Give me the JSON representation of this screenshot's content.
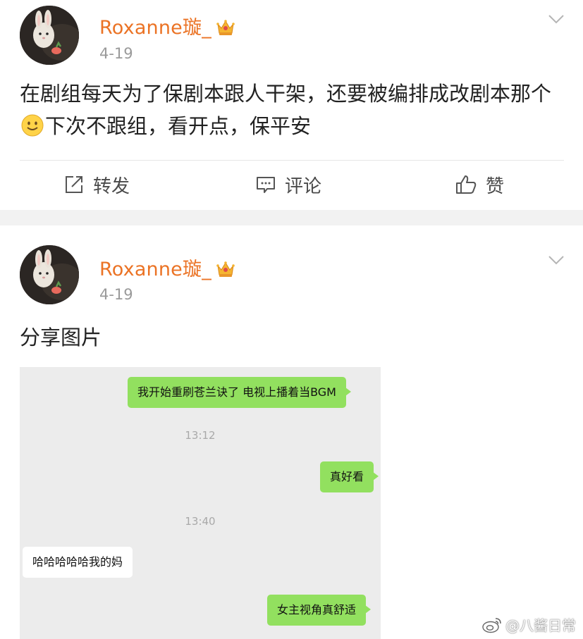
{
  "posts": [
    {
      "username": "Roxanne璇_",
      "date": "4-19",
      "text_before_emoji": "在剧组每天为了保剧本跟人干架，还要被编排成改剧本那个",
      "emoji": "smile-emoji",
      "text_after_emoji": "下次不跟组，看开点，保平安",
      "actions": {
        "repost": "转发",
        "comment": "评论",
        "like": "赞"
      }
    },
    {
      "username": "Roxanne璇_",
      "date": "4-19",
      "text": "分享图片",
      "shared_image": {
        "messages": [
          {
            "side": "me",
            "text": "我开始重刷苍兰诀了 电视上播着当BGM"
          },
          {
            "type": "time",
            "text": "13:12"
          },
          {
            "side": "me",
            "text": "真好看"
          },
          {
            "type": "time",
            "text": "13:40"
          },
          {
            "side": "them",
            "text": "哈哈哈哈哈我的妈"
          },
          {
            "side": "me",
            "text": "女主视角真舒适"
          }
        ]
      }
    }
  ],
  "watermark": {
    "text": "@八酱日常",
    "icon": "weibo-icon"
  },
  "colors": {
    "username": "#eb7325",
    "date": "#9a9a9a",
    "bubble_me": "#92e05f",
    "separator": "#f2f2f2"
  }
}
